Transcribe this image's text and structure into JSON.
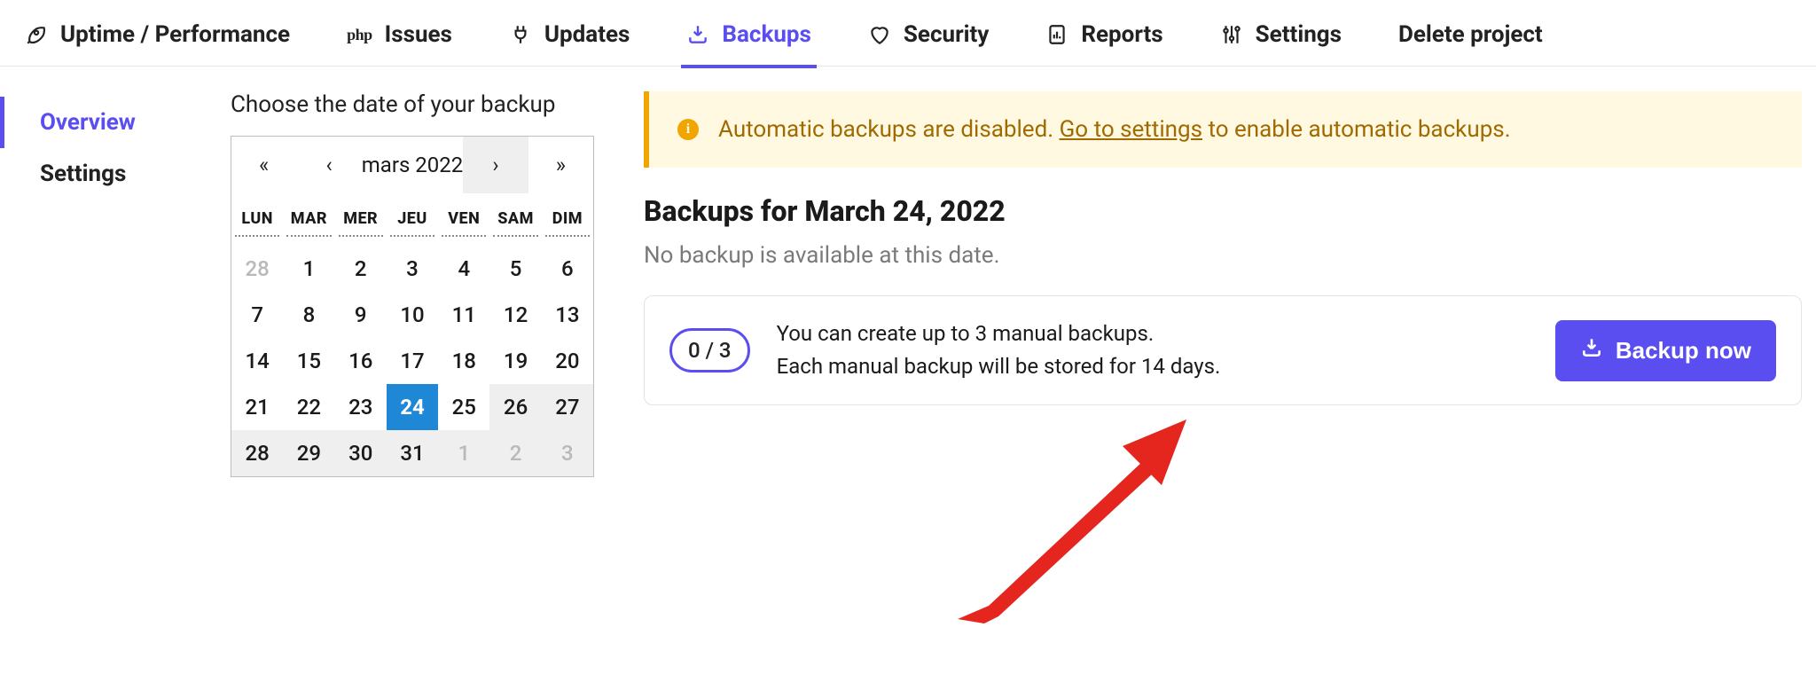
{
  "nav": {
    "uptime": "Uptime / Performance",
    "issues": "Issues",
    "updates": "Updates",
    "backups": "Backups",
    "security": "Security",
    "reports": "Reports",
    "settings": "Settings",
    "delete": "Delete project"
  },
  "sidebar": {
    "overview": "Overview",
    "settings": "Settings"
  },
  "calendar": {
    "title": "Choose the date of your backup",
    "month_label": "mars 2022",
    "nav": {
      "prev2": "«",
      "prev1": "‹",
      "next1": "›",
      "next2": "»"
    },
    "dows": [
      "LUN",
      "MAR",
      "MER",
      "JEU",
      "VEN",
      "SAM",
      "DIM"
    ],
    "cells": [
      {
        "n": "28",
        "muted": true
      },
      {
        "n": "1"
      },
      {
        "n": "2"
      },
      {
        "n": "3"
      },
      {
        "n": "4"
      },
      {
        "n": "5"
      },
      {
        "n": "6"
      },
      {
        "n": "7"
      },
      {
        "n": "8"
      },
      {
        "n": "9"
      },
      {
        "n": "10"
      },
      {
        "n": "11"
      },
      {
        "n": "12"
      },
      {
        "n": "13"
      },
      {
        "n": "14"
      },
      {
        "n": "15"
      },
      {
        "n": "16"
      },
      {
        "n": "17"
      },
      {
        "n": "18"
      },
      {
        "n": "19"
      },
      {
        "n": "20"
      },
      {
        "n": "21"
      },
      {
        "n": "22"
      },
      {
        "n": "23"
      },
      {
        "n": "24",
        "selected": true
      },
      {
        "n": "25"
      },
      {
        "n": "26",
        "wk": true
      },
      {
        "n": "27",
        "wk": true
      },
      {
        "n": "28",
        "wk": true
      },
      {
        "n": "29",
        "wk": true
      },
      {
        "n": "30",
        "wk": true
      },
      {
        "n": "31",
        "wk": true
      },
      {
        "n": "1",
        "muted": true,
        "wk": true
      },
      {
        "n": "2",
        "muted": true,
        "wk": true
      },
      {
        "n": "3",
        "muted": true,
        "wk": true
      }
    ]
  },
  "alert": {
    "pre": "Automatic backups are disabled. ",
    "link": "Go to settings",
    "post": " to enable automatic backups."
  },
  "section": {
    "title": "Backups for March 24, 2022",
    "empty": "No backup is available at this date."
  },
  "card": {
    "ratio": "0 / 3",
    "line1": "You can create up to 3 manual backups.",
    "line2": "Each manual backup will be stored for 14 days.",
    "button": "Backup now"
  }
}
